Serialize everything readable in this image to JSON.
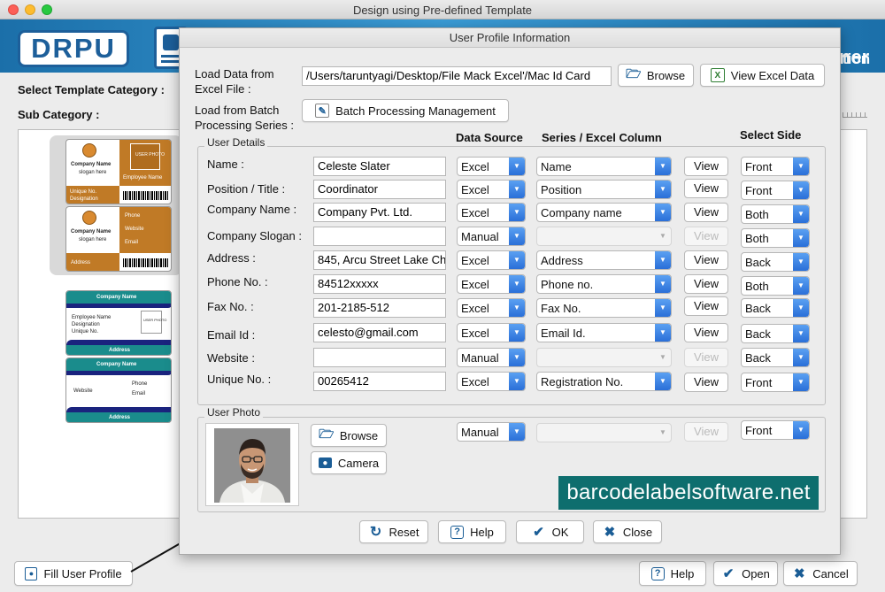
{
  "window": {
    "title": "Design using Pre-defined Template",
    "logo_text": "DRPU",
    "banner_right_top": "ner",
    "banner_right_bottom": "tion"
  },
  "main": {
    "select_template_category_label": "Select Template Category :",
    "sub_category_label": "Sub Category :",
    "templates": [
      {
        "company_name": "Company Name",
        "slogan": "slogan here",
        "unique_no": "Unique No.",
        "designation": "Designation",
        "user_photo": "USER PHOTO",
        "employee_name": "Employee Name",
        "phone": "Phone",
        "website": "Website",
        "email": "Email",
        "address": "Address"
      },
      {
        "company_name": "Company Name",
        "employee_name": "Employee Name",
        "designation": "Designation",
        "unique_no": "Unique No.",
        "user_photo": "USER PHOTO",
        "address": "Address",
        "website": "Website",
        "phone": "Phone",
        "email": "Email"
      }
    ]
  },
  "bottom_bar": {
    "fill_user_profile": "Fill User Profile",
    "help": "Help",
    "open": "Open",
    "cancel": "Cancel"
  },
  "modal": {
    "title": "User Profile Information",
    "load_excel_label_1": "Load Data from",
    "load_excel_label_2": "Excel File :",
    "excel_path": "/Users/taruntyagi/Desktop/File Mack  Excel'/Mac Id Card",
    "browse": "Browse",
    "view_excel_data": "View Excel Data",
    "load_batch_label_1": "Load from Batch",
    "load_batch_label_2": "Processing Series :",
    "batch_processing": "Batch Processing Management",
    "user_details_group": "User Details",
    "col_data_source": "Data Source",
    "col_series": "Series / Excel Column",
    "col_side": "Select Side",
    "rows": [
      {
        "label": "Name :",
        "value": "Celeste Slater",
        "source": "Excel",
        "column": "Name",
        "view": "View",
        "side": "Front",
        "enabled": true
      },
      {
        "label": "Position / Title :",
        "value": "Coordinator",
        "source": "Excel",
        "column": "Position",
        "view": "View",
        "side": "Front",
        "enabled": true
      },
      {
        "label": "Company Name :",
        "value": "Company Pvt. Ltd.",
        "source": "Excel",
        "column": "Company name",
        "view": "View",
        "side": "Both",
        "enabled": true
      },
      {
        "label": "Company Slogan :",
        "value": "",
        "source": "Manual",
        "column": "",
        "view": "View",
        "side": "Both",
        "enabled": false
      },
      {
        "label": "Address :",
        "value": "845, Arcu Street Lake Ch",
        "source": "Excel",
        "column": "Address",
        "view": "View",
        "side": "Back",
        "enabled": true
      },
      {
        "label": "Phone No. :",
        "value": "84512xxxxx",
        "source": "Excel",
        "column": "Phone no.",
        "view": "View",
        "side": "Both",
        "enabled": true
      },
      {
        "label": "Fax No. :",
        "value": "201-2185-512",
        "source": "Excel",
        "column": "Fax No.",
        "view": "View",
        "side": "Back",
        "enabled": true
      },
      {
        "label": "Email Id :",
        "value": "celesto@gmail.com",
        "source": "Excel",
        "column": "Email Id.",
        "view": "View",
        "side": "Back",
        "enabled": true
      },
      {
        "label": "Website :",
        "value": "",
        "source": "Manual",
        "column": "",
        "view": "View",
        "side": "Back",
        "enabled": false
      },
      {
        "label": "Unique No. :",
        "value": "00265412",
        "source": "Excel",
        "column": "Registration No.",
        "view": "View",
        "side": "Front",
        "enabled": true
      }
    ],
    "user_photo_group": "User Photo",
    "photo_browse": "Browse",
    "camera": "Camera",
    "photo_source": "Manual",
    "photo_view": "View",
    "photo_side": "Front",
    "watermark": "barcodelabelsoftware.net",
    "reset": "Reset",
    "help": "Help",
    "ok": "OK",
    "close": "Close"
  }
}
